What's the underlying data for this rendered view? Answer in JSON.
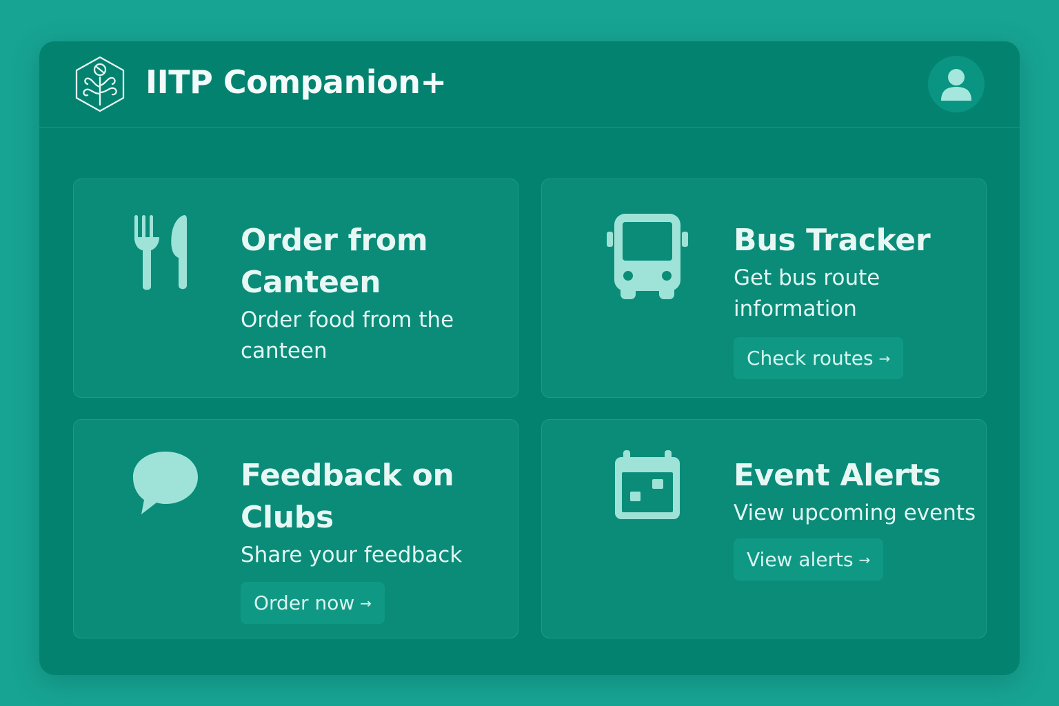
{
  "header": {
    "title": "IITP Companion+",
    "logo_icon": "hexagon-tree-logo-icon",
    "profile_icon": "user-avatar-icon"
  },
  "cards": [
    {
      "title": "Order from Canteen",
      "description": "Order food from the canteen",
      "icon": "fork-knife-icon"
    },
    {
      "title": "Bus Tracker",
      "description": "Get bus route information",
      "icon": "bus-icon",
      "button": "Check routes"
    },
    {
      "title": "Feedback on Clubs",
      "description": "Share your feedback",
      "icon": "speech-bubble-icon",
      "button": "Order now"
    },
    {
      "title": "Event Alerts",
      "description": "View upcoming events",
      "icon": "calendar-icon",
      "button": "View alerts"
    }
  ],
  "arrow_glyph": "→",
  "colors": {
    "background": "#17a493",
    "panel": "#03836f",
    "card": "#0a8c79",
    "icon": "#9fe3d8",
    "text": "#e7f8f4"
  }
}
